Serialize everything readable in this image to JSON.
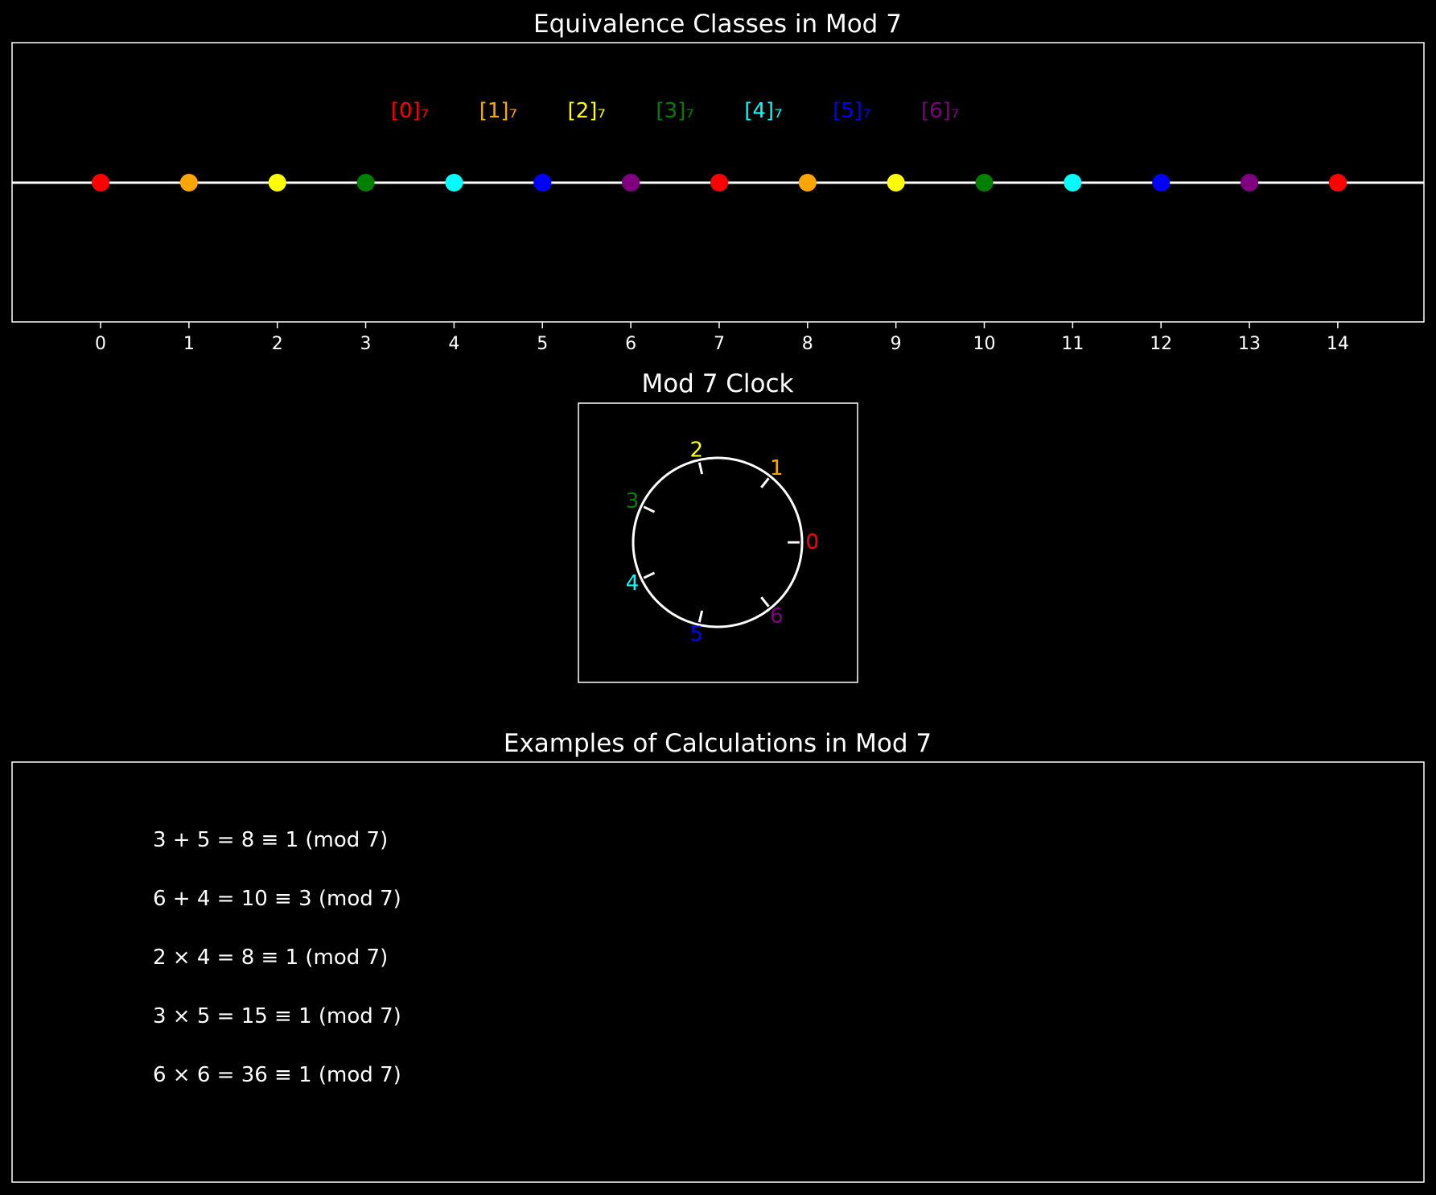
{
  "number_line": {
    "title": "Equivalence Classes in Mod 7",
    "modulus": 7,
    "ticks": [
      "0",
      "1",
      "2",
      "3",
      "4",
      "5",
      "6",
      "7",
      "8",
      "9",
      "10",
      "11",
      "12",
      "13",
      "14"
    ],
    "class_labels": [
      "[0]₇",
      "[1]₇",
      "[2]₇",
      "[3]₇",
      "[4]₇",
      "[5]₇",
      "[6]₇"
    ],
    "points": [
      0,
      1,
      2,
      3,
      4,
      5,
      6,
      7,
      8,
      9,
      10,
      11,
      12,
      13,
      14
    ]
  },
  "clock": {
    "title": "Mod 7 Clock",
    "labels": [
      "0",
      "1",
      "2",
      "3",
      "4",
      "5",
      "6"
    ]
  },
  "calculations": {
    "title": "Examples of Calculations in Mod 7",
    "lines": [
      "3 + 5 = 8 ≡ 1 (mod 7)",
      "6 + 4 = 10 ≡ 3 (mod 7)",
      "2 × 4 = 8 ≡ 1 (mod 7)",
      "3 × 5 = 15 ≡ 1 (mod 7)",
      "6 × 6 = 36 ≡ 1 (mod 7)"
    ]
  },
  "class_colors": [
    "#ff0000",
    "#ffa500",
    "#ffff00",
    "#008000",
    "#00ffff",
    "#0000ff",
    "#800080"
  ]
}
